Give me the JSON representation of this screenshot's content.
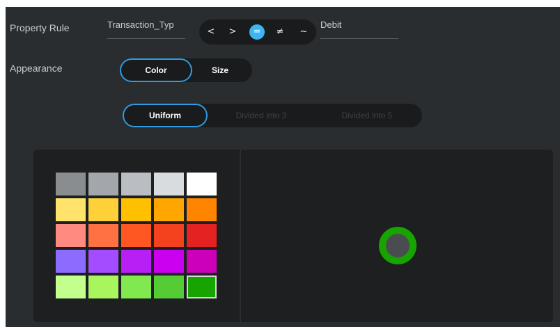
{
  "property_rule": {
    "label": "Property Rule",
    "field_value": "Transaction_Typ",
    "operators": [
      {
        "symbol": "<",
        "active": false
      },
      {
        "symbol": ">",
        "active": false
      },
      {
        "symbol": "=",
        "active": true
      },
      {
        "symbol": "≠",
        "active": false
      },
      {
        "symbol": "~",
        "active": false
      }
    ],
    "value": "Debit"
  },
  "appearance": {
    "label": "Appearance",
    "mode_options": [
      {
        "label": "Color",
        "active": true
      },
      {
        "label": "Size",
        "active": false
      }
    ],
    "distribution_options": [
      {
        "label": "Uniform",
        "active": true
      },
      {
        "label": "Divided into 3",
        "active": false
      },
      {
        "label": "Divided into 5",
        "active": false
      }
    ]
  },
  "palette": {
    "rows": [
      [
        "#8a8d90",
        "#a3a7ab",
        "#babec3",
        "#d9dcdf",
        "#ffffff"
      ],
      [
        "#ffe36b",
        "#ffd138",
        "#ffc000",
        "#ffa600",
        "#ff8500"
      ],
      [
        "#ff8a80",
        "#ff7043",
        "#ff5722",
        "#f4411e",
        "#e52222"
      ],
      [
        "#8c6bff",
        "#a44cff",
        "#b81ff5",
        "#cc00f0",
        "#cc00b8"
      ],
      [
        "#c2ff8c",
        "#a8f55e",
        "#82e84f",
        "#55cc35",
        "#17a300"
      ]
    ],
    "selected": "#17a300"
  },
  "marker": {
    "color": "#17a300",
    "fill": "#4a4d4f"
  }
}
